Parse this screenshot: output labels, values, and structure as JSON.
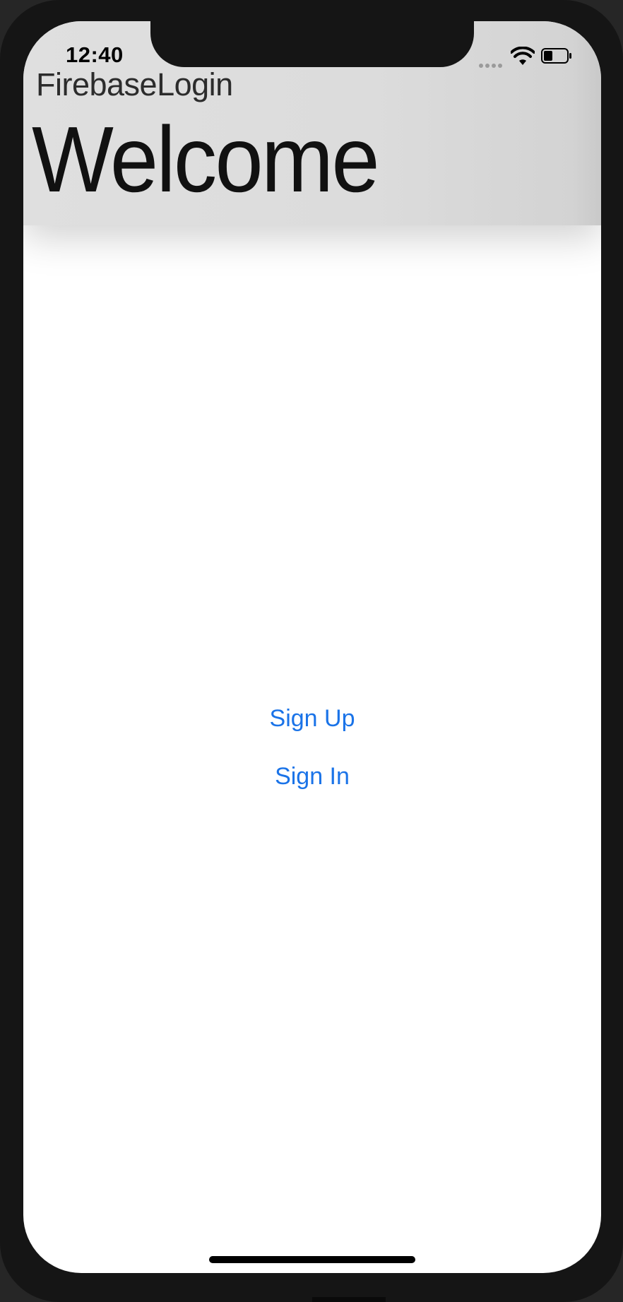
{
  "status_bar": {
    "time": "12:40",
    "signal_icon": "cellular-signal-icon",
    "wifi_icon": "wifi-icon",
    "battery_icon": "battery-icon"
  },
  "header": {
    "app_title": "FirebaseLogin",
    "welcome_text": "Welcome"
  },
  "actions": {
    "sign_up_label": "Sign Up",
    "sign_in_label": "Sign In"
  },
  "colors": {
    "accent": "#1a73e8",
    "header_bg": "#dcdcdc",
    "frame": "#151515"
  }
}
